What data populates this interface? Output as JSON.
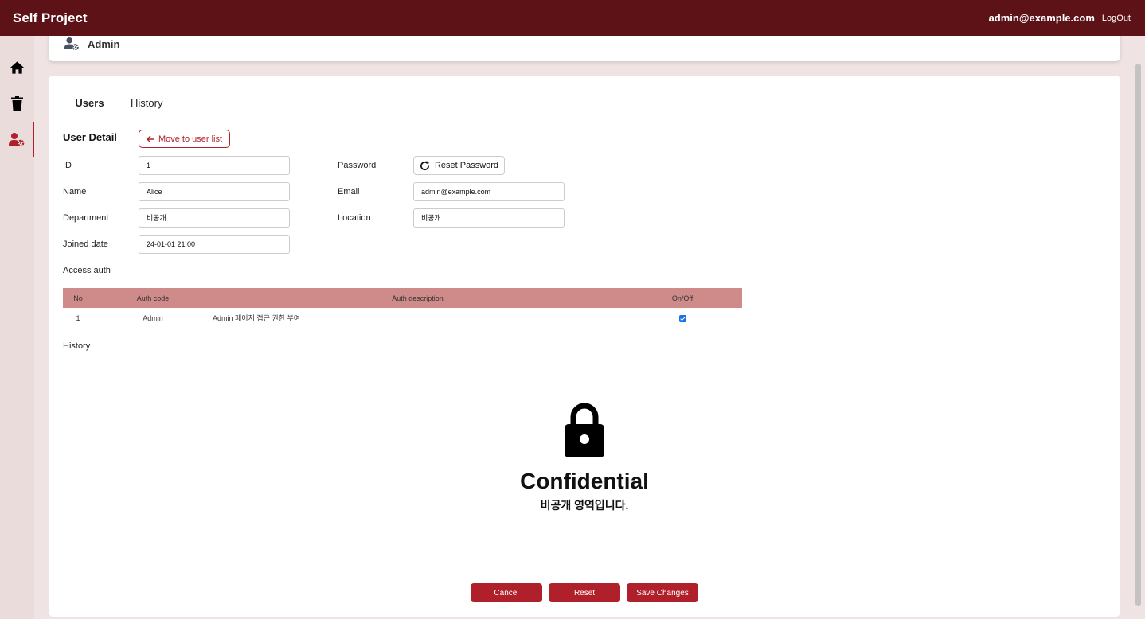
{
  "app": {
    "title": "Self Project"
  },
  "user": {
    "email": "admin@example.com",
    "logout_label": "LogOut"
  },
  "sidebar": {
    "items": [
      {
        "name": "home",
        "icon": "home-icon"
      },
      {
        "name": "trash",
        "icon": "trash-icon"
      },
      {
        "name": "admin",
        "icon": "user-gear-icon",
        "active": true
      }
    ]
  },
  "header": {
    "title": "Admin",
    "icon": "user-gear-icon"
  },
  "tabs": [
    {
      "label": "Users",
      "active": true
    },
    {
      "label": "History",
      "active": false
    }
  ],
  "detail": {
    "title": "User Detail",
    "back_label": "Move to user list",
    "fields": {
      "id": {
        "label": "ID",
        "value": "1"
      },
      "name": {
        "label": "Name",
        "value": "Alice"
      },
      "department": {
        "label": "Department",
        "value": "비공개"
      },
      "joined": {
        "label": "Joined date",
        "value": "24-01-01 21:00"
      },
      "password": {
        "label": "Password",
        "button": "Reset Password"
      },
      "email": {
        "label": "Email",
        "value": "admin@example.com"
      },
      "location": {
        "label": "Location",
        "value": "비공개"
      }
    }
  },
  "access": {
    "title": "Access auth",
    "columns": [
      "No",
      "Auth code",
      "Auth description",
      "On/Off"
    ],
    "rows": [
      {
        "no": "1",
        "code": "Admin",
        "description": "Admin 페이지 접근 권한 부여",
        "on": true
      }
    ]
  },
  "history": {
    "title": "History"
  },
  "confidential": {
    "title": "Confidential",
    "subtitle": "비공개 영역입니다."
  },
  "actions": {
    "cancel": "Cancel",
    "reset": "Reset",
    "save": "Save Changes"
  },
  "colors": {
    "brand": "#5c1216",
    "accent": "#b0202a",
    "table_header": "#cf8a8a"
  }
}
